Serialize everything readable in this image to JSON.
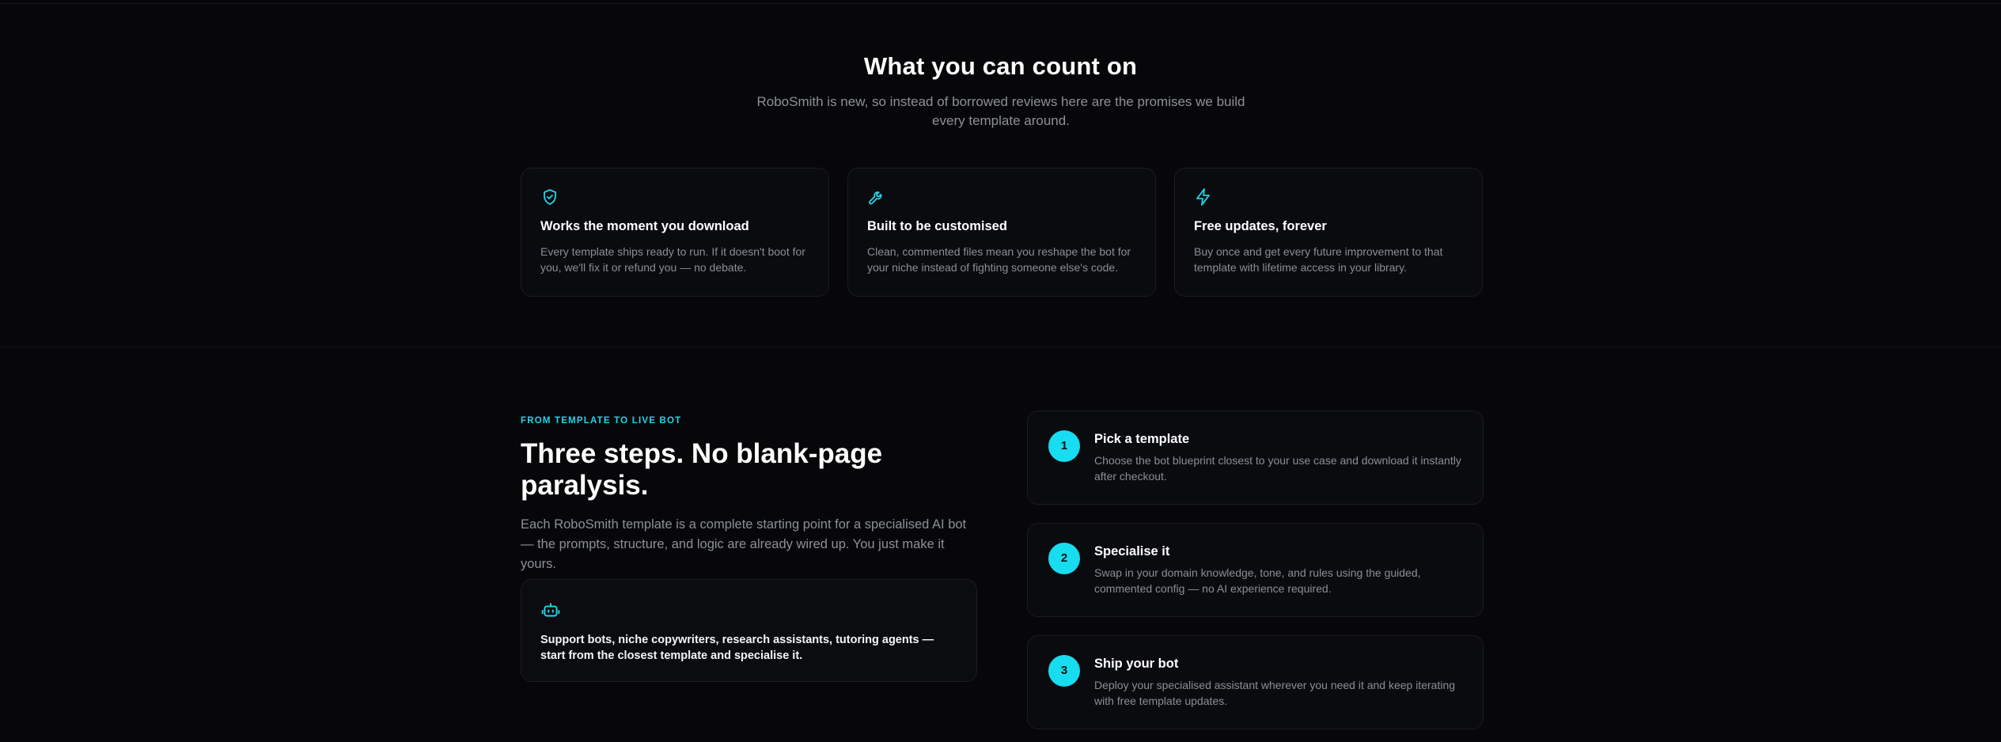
{
  "promises": {
    "title": "What you can count on",
    "subtitle": "RoboSmith is new, so instead of borrowed reviews here are the promises we build every template around.",
    "cards": [
      {
        "icon": "shield-check-icon",
        "title": "Works the moment you download",
        "text": "Every template ships ready to run. If it doesn't boot for you, we'll fix it or refund you — no debate."
      },
      {
        "icon": "wrench-icon",
        "title": "Built to be customised",
        "text": "Clean, commented files mean you reshape the bot for your niche instead of fighting someone else's code."
      },
      {
        "icon": "lightning-icon",
        "title": "Free updates, forever",
        "text": "Buy once and get every future improvement to that template with lifetime access in your library."
      }
    ]
  },
  "steps_section": {
    "eyebrow": "FROM TEMPLATE TO LIVE BOT",
    "title": "Three steps. No blank-page paralysis.",
    "description": "Each RoboSmith template is a complete starting point for a specialised AI bot — the prompts, structure, and logic are already wired up. You just make it yours.",
    "use_case": {
      "icon": "robot-icon",
      "text": "Support bots, niche copywriters, research assistants, tutoring agents — start from the closest template and specialise it."
    },
    "steps": [
      {
        "number": "1",
        "title": "Pick a template",
        "text": "Choose the bot blueprint closest to your use case and download it instantly after checkout."
      },
      {
        "number": "2",
        "title": "Specialise it",
        "text": "Swap in your domain knowledge, tone, and rules using the guided, commented config — no AI experience required."
      },
      {
        "number": "3",
        "title": "Ship your bot",
        "text": "Deploy your specialised assistant wherever you need it and keep iterating with free template updates."
      }
    ]
  },
  "colors": {
    "accent": "#20d6ea",
    "background": "#070709",
    "card_border": "#1b1d22",
    "muted_text": "#8c9098"
  }
}
